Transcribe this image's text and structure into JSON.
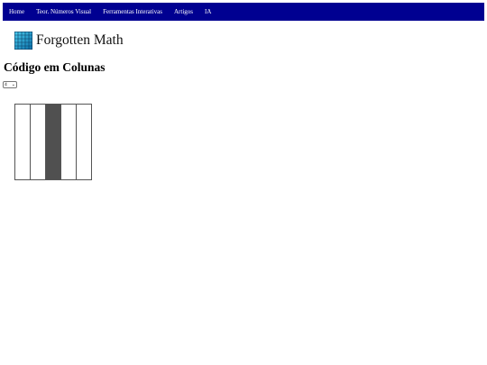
{
  "nav": {
    "items": [
      {
        "label": "Home"
      },
      {
        "label": "Teor. Números Visual"
      },
      {
        "label": "Ferramentas Interativas"
      },
      {
        "label": "Artigos"
      },
      {
        "label": "IA"
      }
    ],
    "background_color": "#000091"
  },
  "brand": {
    "name": "Forgotten Math",
    "icon": "grid-logo-icon"
  },
  "page": {
    "title": "Código em Colunas"
  },
  "column_select": {
    "selected": "4"
  },
  "columns": {
    "states": [
      false,
      false,
      true,
      false,
      false
    ],
    "on_color": "#505050",
    "off_color": "#ffffff"
  }
}
